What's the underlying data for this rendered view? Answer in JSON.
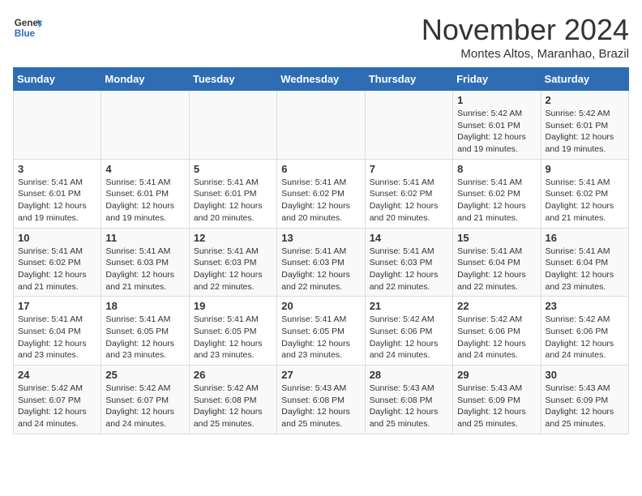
{
  "header": {
    "logo_line1": "General",
    "logo_line2": "Blue",
    "month_title": "November 2024",
    "subtitle": "Montes Altos, Maranhao, Brazil"
  },
  "weekdays": [
    "Sunday",
    "Monday",
    "Tuesday",
    "Wednesday",
    "Thursday",
    "Friday",
    "Saturday"
  ],
  "weeks": [
    [
      {
        "day": "",
        "info": ""
      },
      {
        "day": "",
        "info": ""
      },
      {
        "day": "",
        "info": ""
      },
      {
        "day": "",
        "info": ""
      },
      {
        "day": "",
        "info": ""
      },
      {
        "day": "1",
        "info": "Sunrise: 5:42 AM\nSunset: 6:01 PM\nDaylight: 12 hours and 19 minutes."
      },
      {
        "day": "2",
        "info": "Sunrise: 5:42 AM\nSunset: 6:01 PM\nDaylight: 12 hours and 19 minutes."
      }
    ],
    [
      {
        "day": "3",
        "info": "Sunrise: 5:41 AM\nSunset: 6:01 PM\nDaylight: 12 hours and 19 minutes."
      },
      {
        "day": "4",
        "info": "Sunrise: 5:41 AM\nSunset: 6:01 PM\nDaylight: 12 hours and 19 minutes."
      },
      {
        "day": "5",
        "info": "Sunrise: 5:41 AM\nSunset: 6:01 PM\nDaylight: 12 hours and 20 minutes."
      },
      {
        "day": "6",
        "info": "Sunrise: 5:41 AM\nSunset: 6:02 PM\nDaylight: 12 hours and 20 minutes."
      },
      {
        "day": "7",
        "info": "Sunrise: 5:41 AM\nSunset: 6:02 PM\nDaylight: 12 hours and 20 minutes."
      },
      {
        "day": "8",
        "info": "Sunrise: 5:41 AM\nSunset: 6:02 PM\nDaylight: 12 hours and 21 minutes."
      },
      {
        "day": "9",
        "info": "Sunrise: 5:41 AM\nSunset: 6:02 PM\nDaylight: 12 hours and 21 minutes."
      }
    ],
    [
      {
        "day": "10",
        "info": "Sunrise: 5:41 AM\nSunset: 6:02 PM\nDaylight: 12 hours and 21 minutes."
      },
      {
        "day": "11",
        "info": "Sunrise: 5:41 AM\nSunset: 6:03 PM\nDaylight: 12 hours and 21 minutes."
      },
      {
        "day": "12",
        "info": "Sunrise: 5:41 AM\nSunset: 6:03 PM\nDaylight: 12 hours and 22 minutes."
      },
      {
        "day": "13",
        "info": "Sunrise: 5:41 AM\nSunset: 6:03 PM\nDaylight: 12 hours and 22 minutes."
      },
      {
        "day": "14",
        "info": "Sunrise: 5:41 AM\nSunset: 6:03 PM\nDaylight: 12 hours and 22 minutes."
      },
      {
        "day": "15",
        "info": "Sunrise: 5:41 AM\nSunset: 6:04 PM\nDaylight: 12 hours and 22 minutes."
      },
      {
        "day": "16",
        "info": "Sunrise: 5:41 AM\nSunset: 6:04 PM\nDaylight: 12 hours and 23 minutes."
      }
    ],
    [
      {
        "day": "17",
        "info": "Sunrise: 5:41 AM\nSunset: 6:04 PM\nDaylight: 12 hours and 23 minutes."
      },
      {
        "day": "18",
        "info": "Sunrise: 5:41 AM\nSunset: 6:05 PM\nDaylight: 12 hours and 23 minutes."
      },
      {
        "day": "19",
        "info": "Sunrise: 5:41 AM\nSunset: 6:05 PM\nDaylight: 12 hours and 23 minutes."
      },
      {
        "day": "20",
        "info": "Sunrise: 5:41 AM\nSunset: 6:05 PM\nDaylight: 12 hours and 23 minutes."
      },
      {
        "day": "21",
        "info": "Sunrise: 5:42 AM\nSunset: 6:06 PM\nDaylight: 12 hours and 24 minutes."
      },
      {
        "day": "22",
        "info": "Sunrise: 5:42 AM\nSunset: 6:06 PM\nDaylight: 12 hours and 24 minutes."
      },
      {
        "day": "23",
        "info": "Sunrise: 5:42 AM\nSunset: 6:06 PM\nDaylight: 12 hours and 24 minutes."
      }
    ],
    [
      {
        "day": "24",
        "info": "Sunrise: 5:42 AM\nSunset: 6:07 PM\nDaylight: 12 hours and 24 minutes."
      },
      {
        "day": "25",
        "info": "Sunrise: 5:42 AM\nSunset: 6:07 PM\nDaylight: 12 hours and 24 minutes."
      },
      {
        "day": "26",
        "info": "Sunrise: 5:42 AM\nSunset: 6:08 PM\nDaylight: 12 hours and 25 minutes."
      },
      {
        "day": "27",
        "info": "Sunrise: 5:43 AM\nSunset: 6:08 PM\nDaylight: 12 hours and 25 minutes."
      },
      {
        "day": "28",
        "info": "Sunrise: 5:43 AM\nSunset: 6:08 PM\nDaylight: 12 hours and 25 minutes."
      },
      {
        "day": "29",
        "info": "Sunrise: 5:43 AM\nSunset: 6:09 PM\nDaylight: 12 hours and 25 minutes."
      },
      {
        "day": "30",
        "info": "Sunrise: 5:43 AM\nSunset: 6:09 PM\nDaylight: 12 hours and 25 minutes."
      }
    ]
  ]
}
